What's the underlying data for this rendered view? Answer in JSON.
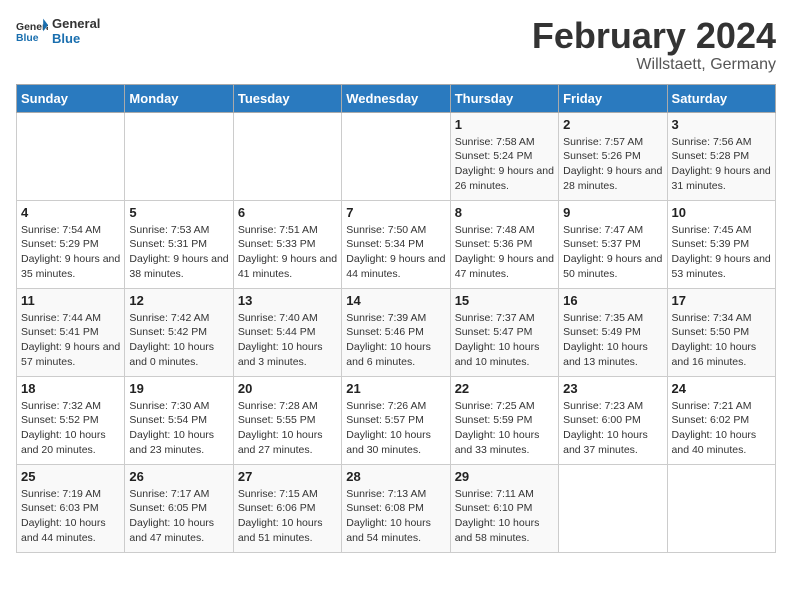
{
  "logo": {
    "text_general": "General",
    "text_blue": "Blue"
  },
  "header": {
    "title": "February 2024",
    "subtitle": "Willstaett, Germany"
  },
  "weekdays": [
    "Sunday",
    "Monday",
    "Tuesday",
    "Wednesday",
    "Thursday",
    "Friday",
    "Saturday"
  ],
  "weeks": [
    [
      {
        "day": "",
        "info": ""
      },
      {
        "day": "",
        "info": ""
      },
      {
        "day": "",
        "info": ""
      },
      {
        "day": "",
        "info": ""
      },
      {
        "day": "1",
        "info": "Sunrise: 7:58 AM\nSunset: 5:24 PM\nDaylight: 9 hours and 26 minutes."
      },
      {
        "day": "2",
        "info": "Sunrise: 7:57 AM\nSunset: 5:26 PM\nDaylight: 9 hours and 28 minutes."
      },
      {
        "day": "3",
        "info": "Sunrise: 7:56 AM\nSunset: 5:28 PM\nDaylight: 9 hours and 31 minutes."
      }
    ],
    [
      {
        "day": "4",
        "info": "Sunrise: 7:54 AM\nSunset: 5:29 PM\nDaylight: 9 hours and 35 minutes."
      },
      {
        "day": "5",
        "info": "Sunrise: 7:53 AM\nSunset: 5:31 PM\nDaylight: 9 hours and 38 minutes."
      },
      {
        "day": "6",
        "info": "Sunrise: 7:51 AM\nSunset: 5:33 PM\nDaylight: 9 hours and 41 minutes."
      },
      {
        "day": "7",
        "info": "Sunrise: 7:50 AM\nSunset: 5:34 PM\nDaylight: 9 hours and 44 minutes."
      },
      {
        "day": "8",
        "info": "Sunrise: 7:48 AM\nSunset: 5:36 PM\nDaylight: 9 hours and 47 minutes."
      },
      {
        "day": "9",
        "info": "Sunrise: 7:47 AM\nSunset: 5:37 PM\nDaylight: 9 hours and 50 minutes."
      },
      {
        "day": "10",
        "info": "Sunrise: 7:45 AM\nSunset: 5:39 PM\nDaylight: 9 hours and 53 minutes."
      }
    ],
    [
      {
        "day": "11",
        "info": "Sunrise: 7:44 AM\nSunset: 5:41 PM\nDaylight: 9 hours and 57 minutes."
      },
      {
        "day": "12",
        "info": "Sunrise: 7:42 AM\nSunset: 5:42 PM\nDaylight: 10 hours and 0 minutes."
      },
      {
        "day": "13",
        "info": "Sunrise: 7:40 AM\nSunset: 5:44 PM\nDaylight: 10 hours and 3 minutes."
      },
      {
        "day": "14",
        "info": "Sunrise: 7:39 AM\nSunset: 5:46 PM\nDaylight: 10 hours and 6 minutes."
      },
      {
        "day": "15",
        "info": "Sunrise: 7:37 AM\nSunset: 5:47 PM\nDaylight: 10 hours and 10 minutes."
      },
      {
        "day": "16",
        "info": "Sunrise: 7:35 AM\nSunset: 5:49 PM\nDaylight: 10 hours and 13 minutes."
      },
      {
        "day": "17",
        "info": "Sunrise: 7:34 AM\nSunset: 5:50 PM\nDaylight: 10 hours and 16 minutes."
      }
    ],
    [
      {
        "day": "18",
        "info": "Sunrise: 7:32 AM\nSunset: 5:52 PM\nDaylight: 10 hours and 20 minutes."
      },
      {
        "day": "19",
        "info": "Sunrise: 7:30 AM\nSunset: 5:54 PM\nDaylight: 10 hours and 23 minutes."
      },
      {
        "day": "20",
        "info": "Sunrise: 7:28 AM\nSunset: 5:55 PM\nDaylight: 10 hours and 27 minutes."
      },
      {
        "day": "21",
        "info": "Sunrise: 7:26 AM\nSunset: 5:57 PM\nDaylight: 10 hours and 30 minutes."
      },
      {
        "day": "22",
        "info": "Sunrise: 7:25 AM\nSunset: 5:59 PM\nDaylight: 10 hours and 33 minutes."
      },
      {
        "day": "23",
        "info": "Sunrise: 7:23 AM\nSunset: 6:00 PM\nDaylight: 10 hours and 37 minutes."
      },
      {
        "day": "24",
        "info": "Sunrise: 7:21 AM\nSunset: 6:02 PM\nDaylight: 10 hours and 40 minutes."
      }
    ],
    [
      {
        "day": "25",
        "info": "Sunrise: 7:19 AM\nSunset: 6:03 PM\nDaylight: 10 hours and 44 minutes."
      },
      {
        "day": "26",
        "info": "Sunrise: 7:17 AM\nSunset: 6:05 PM\nDaylight: 10 hours and 47 minutes."
      },
      {
        "day": "27",
        "info": "Sunrise: 7:15 AM\nSunset: 6:06 PM\nDaylight: 10 hours and 51 minutes."
      },
      {
        "day": "28",
        "info": "Sunrise: 7:13 AM\nSunset: 6:08 PM\nDaylight: 10 hours and 54 minutes."
      },
      {
        "day": "29",
        "info": "Sunrise: 7:11 AM\nSunset: 6:10 PM\nDaylight: 10 hours and 58 minutes."
      },
      {
        "day": "",
        "info": ""
      },
      {
        "day": "",
        "info": ""
      }
    ]
  ]
}
